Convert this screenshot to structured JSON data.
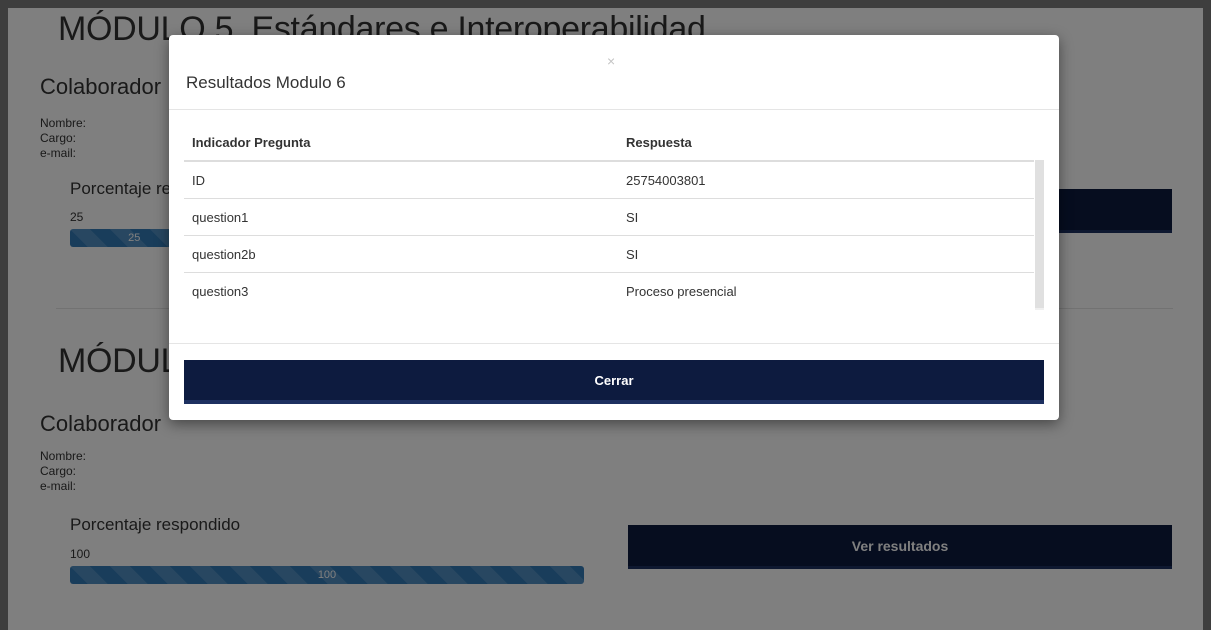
{
  "background": {
    "module5": {
      "title": "MÓDULO 5. Estándares e Interoperabilidad",
      "collaborator_heading": "Colaborador",
      "name_label": "Nombre:",
      "cargo_label": "Cargo:",
      "email_label": "e-mail:",
      "percentage_label": "Porcentaje respondido",
      "percentage_value": "25",
      "progress_percent": 25,
      "progress_text": "25"
    },
    "module6": {
      "title": "MÓDULO 6",
      "collaborator_heading": "Colaborador",
      "name_label": "Nombre:",
      "cargo_label": "Cargo:",
      "email_label": "e-mail:",
      "percentage_label": "Porcentaje respondido",
      "percentage_value": "100",
      "progress_percent": 100,
      "progress_text": "100",
      "results_button": "Ver resultados"
    }
  },
  "modal": {
    "title": "Resultados Modulo 6",
    "close_symbol": "×",
    "table": {
      "headers": [
        "Indicador Pregunta",
        "Respuesta"
      ],
      "rows": [
        [
          "ID",
          "25754003801"
        ],
        [
          "question1",
          "SI"
        ],
        [
          "question2b",
          "SI"
        ],
        [
          "question3",
          "Proceso presencial"
        ]
      ]
    },
    "close_button": "Cerrar"
  },
  "colors": {
    "primary_dark": "#0d1b3f",
    "progress_blue": "#337ab7",
    "overlay": "rgba(0,0,0,0.5)"
  },
  "icons": {
    "close": "close-icon"
  }
}
